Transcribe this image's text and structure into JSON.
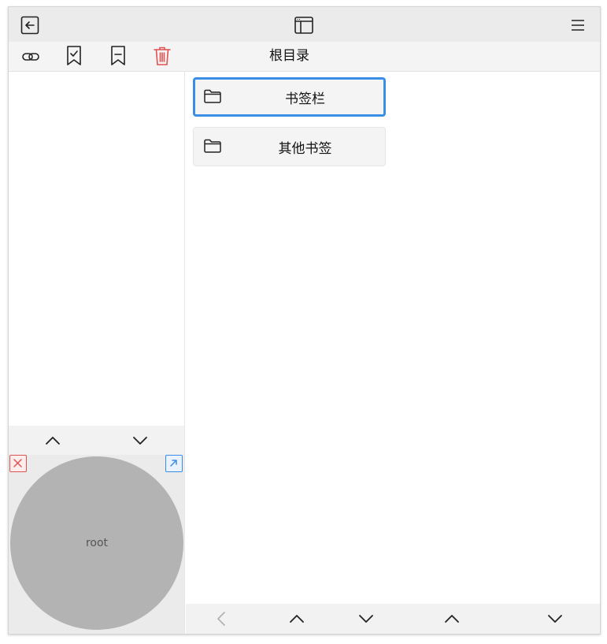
{
  "app": {
    "current_path": "根目录",
    "colors": {
      "accent": "#3a8ee6",
      "danger": "#e05252",
      "panel_bg": "#f2f2f2",
      "preview_circle": "#b3b3b3"
    }
  },
  "topbar": {
    "icons": [
      "back-icon",
      "window-layout-icon",
      "menu-icon"
    ]
  },
  "toolbar": {
    "icons": [
      "link-icon",
      "bookmark-check-icon",
      "bookmark-minus-icon",
      "trash-icon"
    ]
  },
  "folders": [
    {
      "label": "书签栏",
      "selected": true,
      "icon": "folder-icon"
    },
    {
      "label": "其他书签",
      "selected": false,
      "icon": "folder-icon"
    }
  ],
  "preview": {
    "node_label": "root",
    "icons": [
      "close-icon",
      "open-external-icon"
    ]
  },
  "left_nav": {
    "icons": [
      "chevron-up-icon",
      "chevron-down-icon"
    ]
  },
  "bottom_nav": {
    "icons": [
      "chevron-left-icon",
      "chevron-up-icon",
      "chevron-down-icon",
      "chevron-up-icon",
      "chevron-down-icon"
    ]
  }
}
